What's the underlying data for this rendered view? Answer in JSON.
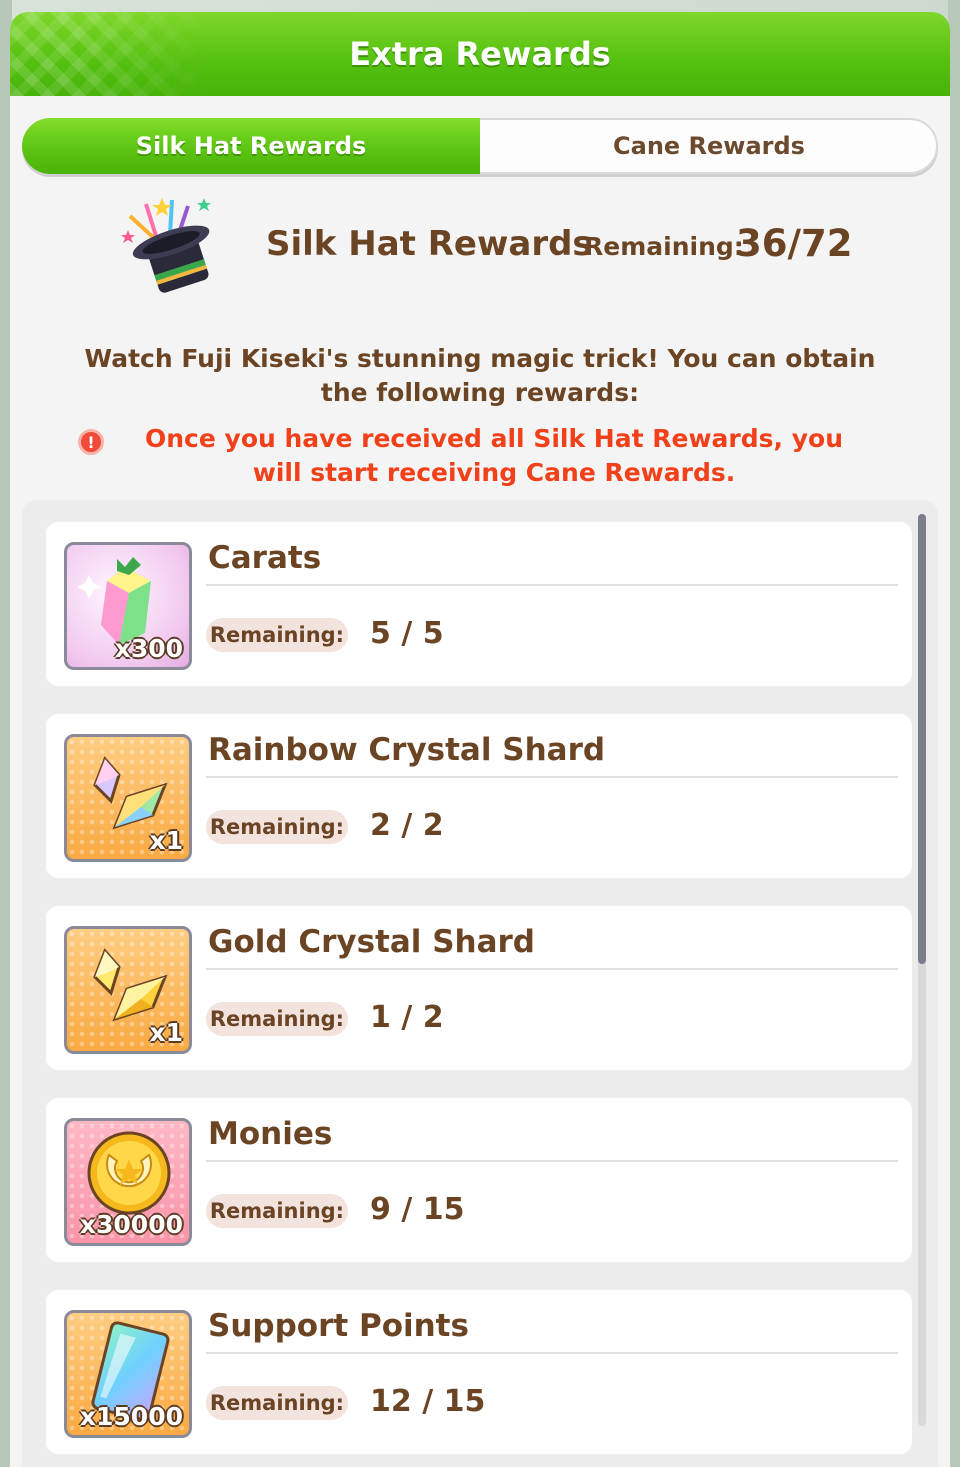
{
  "header": {
    "title": "Extra Rewards"
  },
  "tabs": [
    {
      "label": "Silk Hat Rewards",
      "active": true
    },
    {
      "label": "Cane Rewards",
      "active": false
    }
  ],
  "summary": {
    "title": "Silk Hat Rewards",
    "remaining_label": "Remaining:",
    "remaining_value": "36/72",
    "description": "Watch Fuji Kiseki's stunning magic trick! You can obtain the following rewards:",
    "warning": "Once you have received all Silk Hat Rewards, you will start receiving Cane Rewards.",
    "icon": "silk-hat-icon"
  },
  "rewards": [
    {
      "name": "Carats",
      "quantity": "x300",
      "remaining_label": "Remaining:",
      "remaining": "5 / 5",
      "icon": "carat-crystal-icon"
    },
    {
      "name": "Rainbow Crystal Shard",
      "quantity": "x1",
      "remaining_label": "Remaining:",
      "remaining": "2 / 2",
      "icon": "rainbow-shard-icon"
    },
    {
      "name": "Gold Crystal Shard",
      "quantity": "x1",
      "remaining_label": "Remaining:",
      "remaining": "1 / 2",
      "icon": "gold-shard-icon"
    },
    {
      "name": "Monies",
      "quantity": "x30000",
      "remaining_label": "Remaining:",
      "remaining": "9 / 15",
      "icon": "coin-icon"
    },
    {
      "name": "Support Points",
      "quantity": "x15000",
      "remaining_label": "Remaining:",
      "remaining": "12 / 15",
      "icon": "support-card-icon"
    }
  ],
  "colors": {
    "header_green": "#54c00f",
    "text_brown": "#6b4424",
    "warning_red": "#f2401a"
  }
}
